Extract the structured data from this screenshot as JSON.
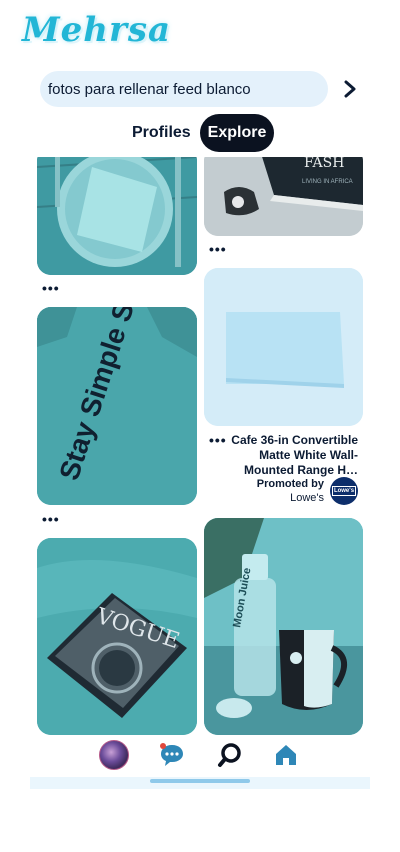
{
  "brand": {
    "logo_text": "Mehrsa"
  },
  "search": {
    "query": "fotos para rellenar feed blanco",
    "go_icon": "chevron-right-icon"
  },
  "tabs": [
    {
      "label": "Profiles",
      "selected": false
    },
    {
      "label": "Explore",
      "selected": true
    }
  ],
  "pins": [
    {
      "id": "plate-napkin",
      "more": "•••"
    },
    {
      "id": "fashion-books",
      "more": "•••"
    },
    {
      "id": "stay-simple-shirt",
      "more": "•••",
      "shirt_text": "Stay Simple Stay True."
    },
    {
      "id": "promoted-range-hood",
      "more": "•••",
      "title": "Cafe 36-in Convertible Matte White Wall-Mounted Range H…",
      "promoted_label": "Promoted by",
      "advertiser": "Lowe's",
      "advertiser_logo_text": "Lowe's"
    },
    {
      "id": "vogue-coffee",
      "magazine_text": "VOGUE"
    },
    {
      "id": "moon-juice-mug",
      "bottle_text": "Moon Juice"
    }
  ],
  "books": {
    "spine_text": "FASH",
    "subtitle": "LIVING IN AFRICA"
  },
  "bottom_nav": [
    {
      "id": "profile",
      "icon": "avatar-icon"
    },
    {
      "id": "messages",
      "icon": "chat-bubble-icon",
      "has_notification": true
    },
    {
      "id": "search",
      "icon": "search-icon"
    },
    {
      "id": "home",
      "icon": "home-icon"
    }
  ],
  "colors": {
    "accent": "#22b6d6",
    "dark": "#0b1220",
    "search_bg": "#e4f1fb",
    "notification": "#e0483c"
  }
}
